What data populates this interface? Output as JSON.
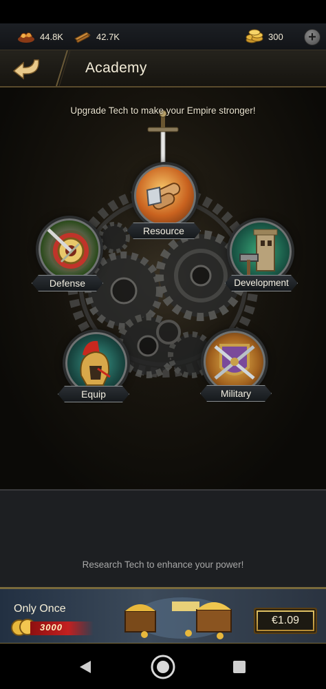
{
  "resources": {
    "food": "44.8K",
    "wood": "42.7K",
    "gold": "300"
  },
  "header": {
    "title": "Academy"
  },
  "main": {
    "subtitle": "Upgrade Tech to make your Empire stronger!",
    "nodes": {
      "resource": "Resource",
      "defense": "Defense",
      "development": "Development",
      "equip": "Equip",
      "military": "Military"
    }
  },
  "info": {
    "text": "Research Tech to enhance your power!"
  },
  "offer": {
    "title": "Only Once",
    "value": "3000",
    "price": "€1.09"
  },
  "icons": [
    "back-arrow-icon",
    "food-icon",
    "wood-icon",
    "gold-coins-icon",
    "plus-icon",
    "sword-icon",
    "treasure-chest-icon",
    "nav-back-icon",
    "nav-home-icon",
    "nav-recents-icon"
  ]
}
